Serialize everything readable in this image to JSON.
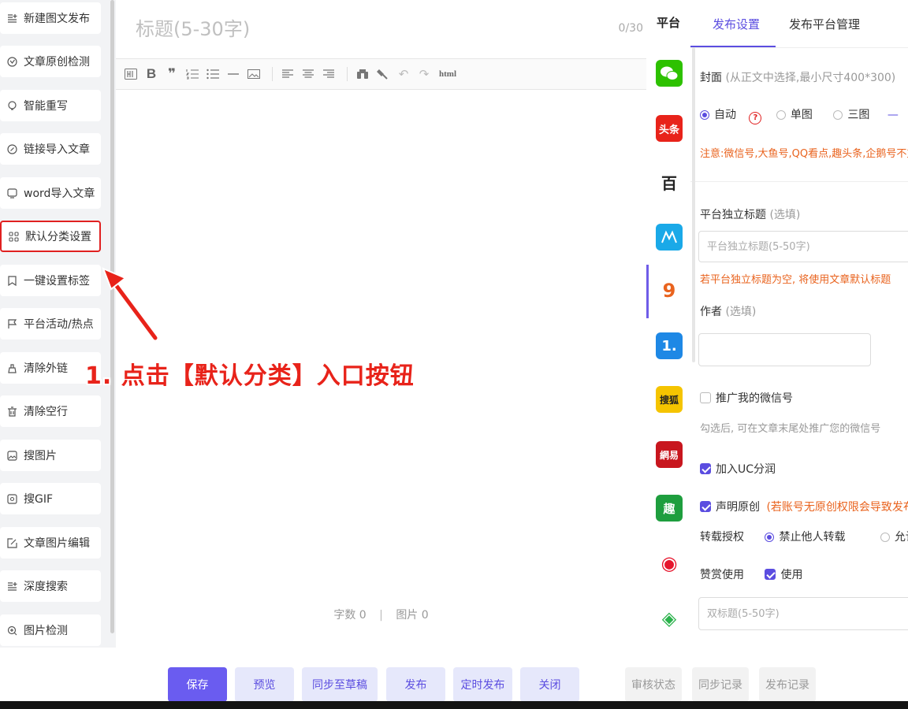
{
  "sidebar": {
    "items": [
      {
        "label": "新建图文发布",
        "icon": "add-document-icon"
      },
      {
        "label": "文章原创检测",
        "icon": "original-check-icon"
      },
      {
        "label": "智能重写",
        "icon": "rewrite-icon"
      },
      {
        "label": "链接导入文章",
        "icon": "link-icon"
      },
      {
        "label": "word导入文章",
        "icon": "word-import-icon"
      },
      {
        "label": "默认分类设置",
        "icon": "category-grid-icon"
      },
      {
        "label": "一键设置标签",
        "icon": "tag-icon"
      },
      {
        "label": "平台活动/热点",
        "icon": "flag-icon"
      },
      {
        "label": "清除外链",
        "icon": "clear-link-icon"
      },
      {
        "label": "清除空行",
        "icon": "trash-icon"
      },
      {
        "label": "搜图片",
        "icon": "image-search-icon"
      },
      {
        "label": "搜GIF",
        "icon": "gif-search-icon"
      },
      {
        "label": "文章图片编辑",
        "icon": "image-edit-icon"
      },
      {
        "label": "深度搜索",
        "icon": "deep-search-icon"
      },
      {
        "label": "图片检测",
        "icon": "image-check-icon"
      }
    ]
  },
  "editor": {
    "title_placeholder": "标题(5-30字)",
    "title_count": "0/30",
    "toolbar_html_label": "html",
    "word_count_label": "字数 0",
    "separator": "|",
    "image_count_label": "图片 0"
  },
  "platforms": {
    "header": "平台",
    "items": [
      {
        "name": "wechat",
        "glyph": "●",
        "color": "#2dc100"
      },
      {
        "name": "toutiao",
        "glyph": "头条",
        "color": "#e8231a"
      },
      {
        "name": "baijiahao",
        "glyph": "百",
        "color": "#ffffff"
      },
      {
        "name": "dayu",
        "glyph": "M",
        "color": "#1aa9e8"
      },
      {
        "name": "qq-kandian",
        "glyph": "9",
        "color": "#ffffff"
      },
      {
        "name": "yidian",
        "glyph": "1.",
        "color": "#1e88e5"
      },
      {
        "name": "sohu",
        "glyph": "搜狐",
        "color": "#f5c400"
      },
      {
        "name": "netease",
        "glyph": "網易",
        "color": "#c8161e"
      },
      {
        "name": "qutoutiao",
        "glyph": "趣",
        "color": "#1e9e3e"
      },
      {
        "name": "weibo",
        "glyph": "◉",
        "color": "#ffffff"
      },
      {
        "name": "qiehao",
        "glyph": "◈",
        "color": "#ffffff"
      }
    ]
  },
  "panel": {
    "tabs": [
      "发布设置",
      "发布平台管理"
    ],
    "cover_label": "封面",
    "cover_hint": "(从正文中选择,最小尺寸400*300)",
    "cover_options": [
      "自动",
      "单图",
      "三图"
    ],
    "cover_warning": "注意:微信号,大鱼号,QQ看点,趣头条,企鹅号不支",
    "platform_title_label": "平台独立标题",
    "optional": "(选填)",
    "platform_title_placeholder": "平台独立标题(5-50字)",
    "platform_title_warning": "若平台独立标题为空, 将使用文章默认标题",
    "author_label": "作者",
    "promote_wechat": "推广我的微信号",
    "promote_hint": "勾选后, 可在文章末尾处推广您的微信号",
    "uc_share": "加入UC分润",
    "declare_original": "声明原创",
    "declare_warning": "(若账号无原创权限会导致发布失",
    "repost_label": "转载授权",
    "repost_options": [
      "禁止他人转载",
      "允许"
    ],
    "reward_label": "赞赏使用",
    "reward_use": "使用",
    "double_title_placeholder": "双标题(5-50字)"
  },
  "bottom": {
    "buttons": [
      "保存",
      "预览",
      "同步至草稿",
      "发布",
      "定时发布",
      "关闭"
    ],
    "secondary": [
      "审核状态",
      "同步记录",
      "发布记录"
    ]
  },
  "annotation": {
    "text": "1. 点击【默认分类】入口按钮",
    "color": "#e8231a"
  }
}
